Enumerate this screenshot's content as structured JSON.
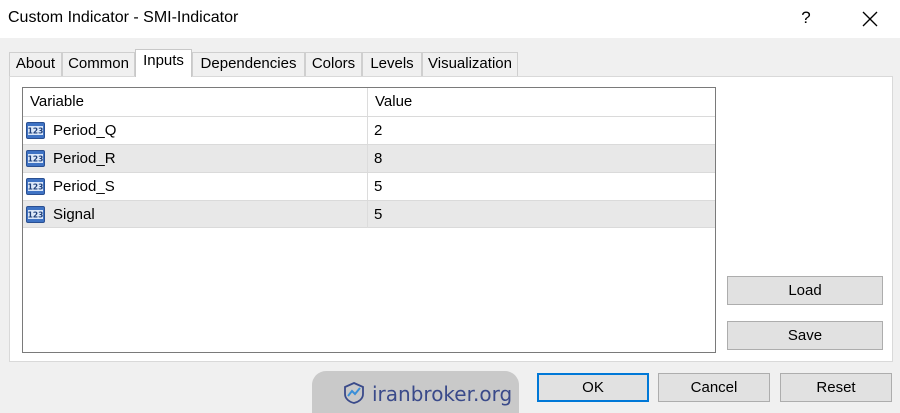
{
  "window": {
    "title": "Custom Indicator - SMI-Indicator",
    "help_label": "?",
    "close_icon": "close-icon"
  },
  "tabs": [
    {
      "label": "About",
      "active": false
    },
    {
      "label": "Common",
      "active": false
    },
    {
      "label": "Inputs",
      "active": true
    },
    {
      "label": "Dependencies",
      "active": false
    },
    {
      "label": "Colors",
      "active": false
    },
    {
      "label": "Levels",
      "active": false
    },
    {
      "label": "Visualization",
      "active": false
    }
  ],
  "inputs_table": {
    "columns": [
      "Variable",
      "Value"
    ],
    "rows": [
      {
        "icon": "integer-type-icon",
        "variable": "Period_Q",
        "value": "2"
      },
      {
        "icon": "integer-type-icon",
        "variable": "Period_R",
        "value": "8"
      },
      {
        "icon": "integer-type-icon",
        "variable": "Period_S",
        "value": "5"
      },
      {
        "icon": "integer-type-icon",
        "variable": "Signal",
        "value": "5"
      }
    ],
    "icon_label": "123"
  },
  "side_buttons": {
    "load_label": "Load",
    "save_label": "Save"
  },
  "footer": {
    "ok_label": "OK",
    "cancel_label": "Cancel",
    "reset_label": "Reset"
  },
  "watermark": {
    "text": "iranbroker.org"
  },
  "colors": {
    "accent": "#0078d7",
    "row_alt": "#e8e8e8",
    "watermark_text": "#3a4a8a"
  }
}
